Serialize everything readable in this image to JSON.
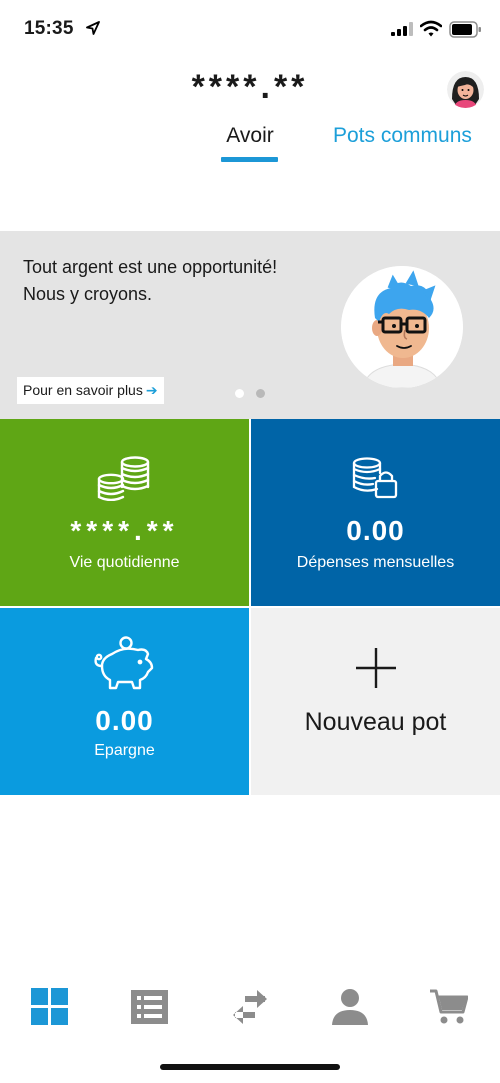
{
  "status_bar": {
    "time": "15:35",
    "icons": [
      "location-arrow-icon",
      "cellular-signal-icon",
      "wifi-icon",
      "battery-icon"
    ]
  },
  "header": {
    "balance": "****.**",
    "avatar_icon": "user-avatar-icon"
  },
  "tabs": [
    {
      "label": "Avoir",
      "active": true
    },
    {
      "label": "Pots communs",
      "active": false
    }
  ],
  "banner": {
    "line1": "Tout argent est une opportunité!",
    "line2": "Nous y croyons.",
    "link_label": "Pour en savoir plus",
    "link_arrow": "➔",
    "page_count": 2,
    "active_page": 1,
    "illustration": "person-with-blue-hair-illustration"
  },
  "tiles": [
    {
      "value": "****.**",
      "label": "Vie quotidienne",
      "icon": "coins-stack-icon",
      "color": "#5fa615"
    },
    {
      "value": "0.00",
      "label": "Dépenses mensuelles",
      "icon": "coins-lock-icon",
      "color": "#0064a7"
    },
    {
      "value": "0.00",
      "label": "Epargne",
      "icon": "piggy-bank-icon",
      "color": "#0a9bdf"
    },
    {
      "label": "Nouveau pot",
      "icon": "plus-icon",
      "color": "#f1f1f1"
    }
  ],
  "bottom_nav": [
    {
      "icon": "dashboard-grid-icon",
      "active": true
    },
    {
      "icon": "list-icon",
      "active": false
    },
    {
      "icon": "transfer-arrows-icon",
      "active": false
    },
    {
      "icon": "profile-icon",
      "active": false
    },
    {
      "icon": "shopping-cart-icon",
      "active": false
    }
  ],
  "colors": {
    "accent": "#1c97d6",
    "green": "#5fa615",
    "dark_blue": "#0064a7",
    "blue": "#0a9bdf",
    "nav_inactive": "#8c8c8c"
  }
}
